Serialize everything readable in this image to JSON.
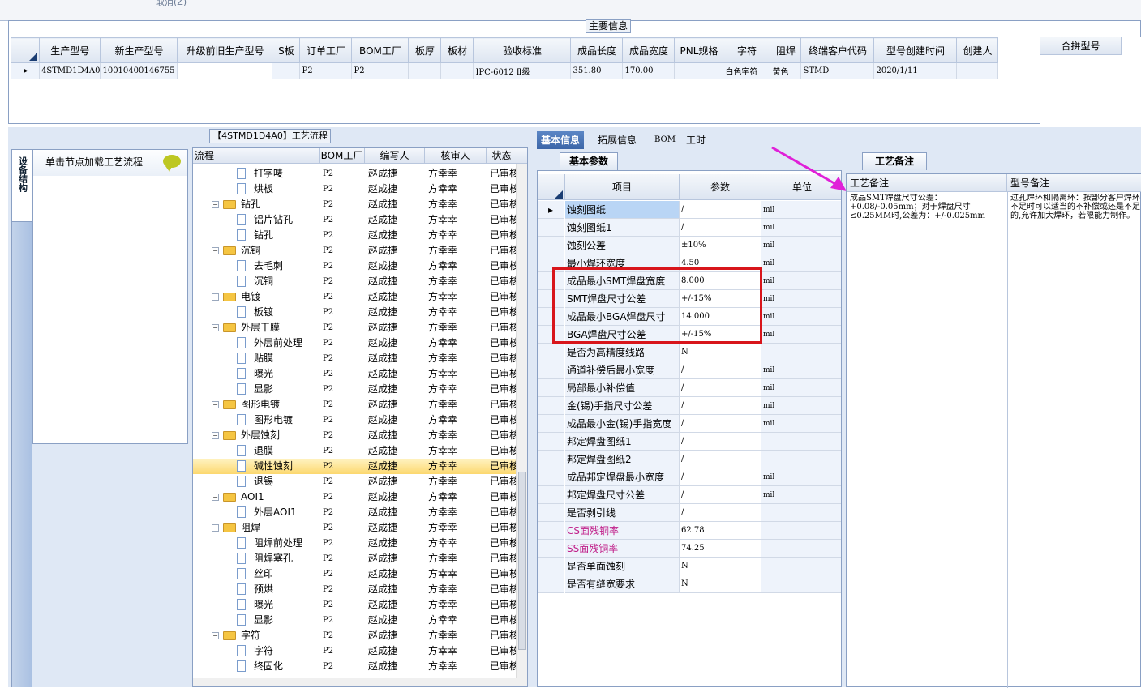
{
  "top_strip_text": "取消(Z)",
  "main_info_title": "主要信息",
  "main_table": {
    "headers": [
      "生产型号",
      "新生产型号",
      "升级前旧生产型号",
      "S板",
      "订单工厂",
      "BOM工厂",
      "板厚",
      "板材",
      "验收标准",
      "成品长度",
      "成品宽度",
      "PNL规格",
      "字符",
      "阻焊",
      "终端客户代码",
      "型号创建时间",
      "创建人"
    ],
    "row": [
      "4STMD1D4A0",
      "10010400146755",
      "",
      "",
      "P2",
      "P2",
      "",
      "",
      "IPC-6012 Ⅱ级",
      "351.80",
      "170.00",
      "",
      "白色字符",
      "黄色",
      "STMD",
      "2020/1/11",
      ""
    ]
  },
  "merge_header": "合拼型号",
  "flow_title": "【4STMD1D4A0】工艺流程",
  "left_tab_label": "设备结构",
  "left_panel_header": "单击节点加载工艺流程",
  "tree": {
    "headers": [
      "流程",
      "BOM工厂",
      "编写人",
      "核审人",
      "状态"
    ],
    "rows": [
      {
        "name": "打字唛",
        "level": 2,
        "bom": "P2",
        "editor": "赵成捷",
        "reviewer": "方幸幸",
        "status": "已审核"
      },
      {
        "name": "烘板",
        "level": 2,
        "bom": "P2",
        "editor": "赵成捷",
        "reviewer": "方幸幸",
        "status": "已审核"
      },
      {
        "name": "钻孔",
        "level": 1,
        "bom": "P2",
        "editor": "赵成捷",
        "reviewer": "方幸幸",
        "status": "已审核"
      },
      {
        "name": "铝片钻孔",
        "level": 2,
        "bom": "P2",
        "editor": "赵成捷",
        "reviewer": "方幸幸",
        "status": "已审核"
      },
      {
        "name": "钻孔",
        "level": 2,
        "bom": "P2",
        "editor": "赵成捷",
        "reviewer": "方幸幸",
        "status": "已审核"
      },
      {
        "name": "沉铜",
        "level": 1,
        "bom": "P2",
        "editor": "赵成捷",
        "reviewer": "方幸幸",
        "status": "已审核"
      },
      {
        "name": "去毛刺",
        "level": 2,
        "bom": "P2",
        "editor": "赵成捷",
        "reviewer": "方幸幸",
        "status": "已审核"
      },
      {
        "name": "沉铜",
        "level": 2,
        "bom": "P2",
        "editor": "赵成捷",
        "reviewer": "方幸幸",
        "status": "已审核"
      },
      {
        "name": "电镀",
        "level": 1,
        "bom": "P2",
        "editor": "赵成捷",
        "reviewer": "方幸幸",
        "status": "已审核"
      },
      {
        "name": "板镀",
        "level": 2,
        "bom": "P2",
        "editor": "赵成捷",
        "reviewer": "方幸幸",
        "status": "已审核"
      },
      {
        "name": "外层干膜",
        "level": 1,
        "bom": "P2",
        "editor": "赵成捷",
        "reviewer": "方幸幸",
        "status": "已审核"
      },
      {
        "name": "外层前处理",
        "level": 2,
        "bom": "P2",
        "editor": "赵成捷",
        "reviewer": "方幸幸",
        "status": "已审核"
      },
      {
        "name": "贴膜",
        "level": 2,
        "bom": "P2",
        "editor": "赵成捷",
        "reviewer": "方幸幸",
        "status": "已审核"
      },
      {
        "name": "曝光",
        "level": 2,
        "bom": "P2",
        "editor": "赵成捷",
        "reviewer": "方幸幸",
        "status": "已审核"
      },
      {
        "name": "显影",
        "level": 2,
        "bom": "P2",
        "editor": "赵成捷",
        "reviewer": "方幸幸",
        "status": "已审核"
      },
      {
        "name": "图形电镀",
        "level": 1,
        "bom": "P2",
        "editor": "赵成捷",
        "reviewer": "方幸幸",
        "status": "已审核"
      },
      {
        "name": "图形电镀",
        "level": 2,
        "bom": "P2",
        "editor": "赵成捷",
        "reviewer": "方幸幸",
        "status": "已审核"
      },
      {
        "name": "外层蚀刻",
        "level": 1,
        "bom": "P2",
        "editor": "赵成捷",
        "reviewer": "方幸幸",
        "status": "已审核"
      },
      {
        "name": "退膜",
        "level": 2,
        "bom": "P2",
        "editor": "赵成捷",
        "reviewer": "方幸幸",
        "status": "已审核"
      },
      {
        "name": "碱性蚀刻",
        "level": 2,
        "bom": "P2",
        "editor": "赵成捷",
        "reviewer": "方幸幸",
        "status": "已审核",
        "selected": true
      },
      {
        "name": "退锡",
        "level": 2,
        "bom": "P2",
        "editor": "赵成捷",
        "reviewer": "方幸幸",
        "status": "已审核"
      },
      {
        "name": "AOI1",
        "level": 1,
        "bom": "P2",
        "editor": "赵成捷",
        "reviewer": "方幸幸",
        "status": "已审核"
      },
      {
        "name": "外层AOI1",
        "level": 2,
        "bom": "P2",
        "editor": "赵成捷",
        "reviewer": "方幸幸",
        "status": "已审核"
      },
      {
        "name": "阻焊",
        "level": 1,
        "bom": "P2",
        "editor": "赵成捷",
        "reviewer": "方幸幸",
        "status": "已审核"
      },
      {
        "name": "阻焊前处理",
        "level": 2,
        "bom": "P2",
        "editor": "赵成捷",
        "reviewer": "方幸幸",
        "status": "已审核"
      },
      {
        "name": "阻焊塞孔",
        "level": 2,
        "bom": "P2",
        "editor": "赵成捷",
        "reviewer": "方幸幸",
        "status": "已审核"
      },
      {
        "name": "丝印",
        "level": 2,
        "bom": "P2",
        "editor": "赵成捷",
        "reviewer": "方幸幸",
        "status": "已审核"
      },
      {
        "name": "预烘",
        "level": 2,
        "bom": "P2",
        "editor": "赵成捷",
        "reviewer": "方幸幸",
        "status": "已审核"
      },
      {
        "name": "曝光",
        "level": 2,
        "bom": "P2",
        "editor": "赵成捷",
        "reviewer": "方幸幸",
        "status": "已审核"
      },
      {
        "name": "显影",
        "level": 2,
        "bom": "P2",
        "editor": "赵成捷",
        "reviewer": "方幸幸",
        "status": "已审核"
      },
      {
        "name": "字符",
        "level": 1,
        "bom": "P2",
        "editor": "赵成捷",
        "reviewer": "方幸幸",
        "status": "已审核"
      },
      {
        "name": "字符",
        "level": 2,
        "bom": "P2",
        "editor": "赵成捷",
        "reviewer": "方幸幸",
        "status": "已审核"
      },
      {
        "name": "终固化",
        "level": 2,
        "bom": "P2",
        "editor": "赵成捷",
        "reviewer": "方幸幸",
        "status": "已审核"
      }
    ]
  },
  "tabs": [
    "基本信息",
    "拓展信息",
    "BOM",
    "工时"
  ],
  "basic_sub_tab": "基本参数",
  "params": {
    "headers": [
      "项目",
      "参数",
      "单位"
    ],
    "rows": [
      {
        "item": "蚀刻图纸",
        "value": "/",
        "unit": "mil"
      },
      {
        "item": "蚀刻图纸1",
        "value": "/",
        "unit": "mil"
      },
      {
        "item": "蚀刻公差",
        "value": "±10%",
        "unit": "mil"
      },
      {
        "item": "最小焊环宽度",
        "value": "4.50",
        "unit": "mil"
      },
      {
        "item": "成品最小SMT焊盘宽度",
        "value": "8.000",
        "unit": "mil"
      },
      {
        "item": "SMT焊盘尺寸公差",
        "value": "+/-15%",
        "unit": "mil"
      },
      {
        "item": "成品最小BGA焊盘尺寸",
        "value": "14.000",
        "unit": "mil"
      },
      {
        "item": "BGA焊盘尺寸公差",
        "value": "+/-15%",
        "unit": "mil"
      },
      {
        "item": "是否为高精度线路",
        "value": "N",
        "unit": ""
      },
      {
        "item": "通道补偿后最小宽度",
        "value": "/",
        "unit": "mil"
      },
      {
        "item": "局部最小补偿值",
        "value": "/",
        "unit": "mil"
      },
      {
        "item": "金(锡)手指尺寸公差",
        "value": "/",
        "unit": "mil"
      },
      {
        "item": "成品最小金(锡)手指宽度",
        "value": "/",
        "unit": "mil"
      },
      {
        "item": "邦定焊盘图纸1",
        "value": "/",
        "unit": ""
      },
      {
        "item": "邦定焊盘图纸2",
        "value": "/",
        "unit": ""
      },
      {
        "item": "成品邦定焊盘最小宽度",
        "value": "/",
        "unit": "mil"
      },
      {
        "item": "邦定焊盘尺寸公差",
        "value": "/",
        "unit": "mil"
      },
      {
        "item": "是否剥引线",
        "value": "/",
        "unit": ""
      },
      {
        "item": "CS面残铜率",
        "value": "62.78",
        "unit": "",
        "pink": true
      },
      {
        "item": "SS面残铜率",
        "value": "74.25",
        "unit": "",
        "pink": true
      },
      {
        "item": "是否单面蚀刻",
        "value": "N",
        "unit": ""
      },
      {
        "item": "是否有缝宽要求",
        "value": "N",
        "unit": ""
      }
    ]
  },
  "process_notes_tab": "工艺备注",
  "notes": {
    "headers": [
      "工艺备注",
      "型号备注"
    ],
    "process_note": "成品SMT焊盘尺寸公差：+0.08/-0.05mm；对于焊盘尺寸≤0.25MM时,公差为：+/-0.025mm",
    "model_note": "过孔焊环和隔离环：按部分客户焊环不足时可以适当的不补偿或还是不足的,允许加大焊环，若限能力制作。"
  },
  "colors": {
    "accent": "#3c66a8",
    "highlight_box": "#d8151b",
    "arrow": "#e020d8",
    "pink_text": "#c0208a"
  }
}
